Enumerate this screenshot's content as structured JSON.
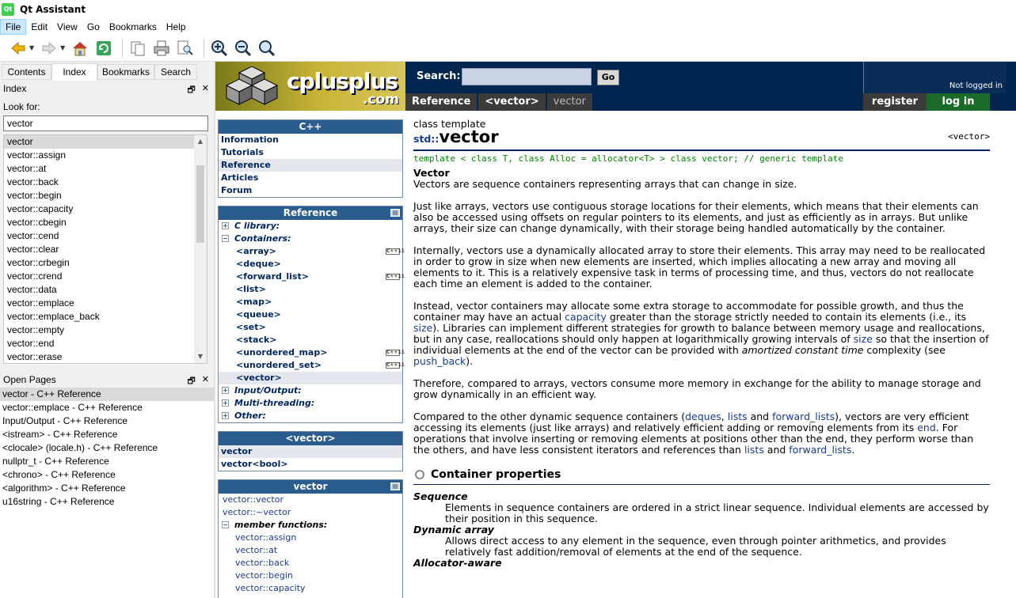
{
  "window": {
    "title": "Qt Assistant",
    "app_icon_label": "Qt"
  },
  "menu": [
    "File",
    "Edit",
    "View",
    "Go",
    "Bookmarks",
    "Help"
  ],
  "left_tabs": [
    "Contents",
    "Index",
    "Bookmarks",
    "Search"
  ],
  "index": {
    "dock_title": "Index",
    "look_for_label": "Look for:",
    "search_value": "vector",
    "items": [
      "vector",
      "vector::assign",
      "vector::at",
      "vector::back",
      "vector::begin",
      "vector::capacity",
      "vector::cbegin",
      "vector::cend",
      "vector::clear",
      "vector::crbegin",
      "vector::crend",
      "vector::data",
      "vector::emplace",
      "vector::emplace_back",
      "vector::empty",
      "vector::end",
      "vector::erase"
    ]
  },
  "open_pages": {
    "dock_title": "Open Pages",
    "items": [
      "vector - C++ Reference",
      "vector::emplace - C++ Reference",
      "Input/Output - C++ Reference",
      "<istream> - C++ Reference",
      "<clocale> (locale.h) - C++ Reference",
      "nullptr_t - C++ Reference",
      "<chrono> - C++ Reference",
      "<algorithm> - C++ Reference",
      "u16string - C++ Reference"
    ]
  },
  "site": {
    "logo_word": "cplusplus",
    "logo_com": ".com",
    "search_label": "Search:",
    "go_label": "Go",
    "not_logged": "Not logged in",
    "register_label": "register",
    "login_label": "log in",
    "breadcrumbs": [
      "Reference",
      "<vector>",
      "vector"
    ]
  },
  "nav": {
    "cpp_box": {
      "title": "C++",
      "links": [
        "Information",
        "Tutorials",
        "Reference",
        "Articles",
        "Forum"
      ]
    },
    "ref_box": {
      "title": "Reference",
      "cats": [
        "C library:",
        "Containers:"
      ],
      "headers": [
        "<array>",
        "<deque>",
        "<forward_list>",
        "<list>",
        "<map>",
        "<queue>",
        "<set>",
        "<stack>",
        "<unordered_map>",
        "<unordered_set>",
        "<vector>"
      ],
      "cats2": [
        "Input/Output:",
        "Multi-threading:",
        "Other:"
      ],
      "cxx_badge": "C++11"
    },
    "vector_box": {
      "title": "<vector>",
      "links": [
        "vector",
        "vector<bool>"
      ]
    },
    "members_box": {
      "title": "vector",
      "items": [
        "vector::vector",
        "vector::~vector"
      ],
      "cat": "member functions:",
      "subs": [
        "vector::assign",
        "vector::at",
        "vector::back",
        "vector::begin",
        "vector::capacity"
      ]
    }
  },
  "article": {
    "class_template": "class template",
    "ns": "std::",
    "name": "vector",
    "header": "<vector>",
    "decl": "template < class T, class Alloc = allocator<T> > class vector; // generic template",
    "subtitle": "Vector",
    "p1": "Vectors are sequence containers representing arrays that can change in size.",
    "p2": "Just like arrays, vectors use contiguous storage locations for their elements, which means that their elements can also be accessed using offsets on regular pointers to its elements, and just as efficiently as in arrays. But unlike arrays, their size can change dynamically, with their storage being handled automatically by the container.",
    "p3": "Internally, vectors use a dynamically allocated array to store their elements. This array may need to be reallocated in order to grow in size when new elements are inserted, which implies allocating a new array and moving all elements to it. This is a relatively expensive task in terms of processing time, and thus, vectors do not reallocate each time an element is added to the container.",
    "p4a": "Instead, vector containers may allocate some extra storage to accommodate for possible growth, and thus the container may have an actual ",
    "p4_capacity": "capacity",
    "p4b": " greater than the storage strictly needed to contain its elements (i.e., its ",
    "p4_size": "size",
    "p4c": "). Libraries can implement different strategies for growth to balance between memory usage and reallocations, but in any case, reallocations should only happen at logarithmically growing intervals of ",
    "p4_size2": "size",
    "p4d": " so that the insertion of individual elements at the end of the vector can be provided with ",
    "p4_amortized": "amortized constant time",
    "p4e": " complexity (see ",
    "p4_push": "push_back",
    "p4f": ").",
    "p5": "Therefore, compared to arrays, vectors consume more memory in exchange for the ability to manage storage and grow dynamically in an efficient way.",
    "p6a": "Compared to the other dynamic sequence containers (",
    "p6_deques": "deques",
    "p6_sep1": ", ",
    "p6_lists": "lists",
    "p6_and": " and ",
    "p6_fwd": "forward_lists",
    "p6b": "), vectors are very efficient accessing its elements (just like arrays) and relatively efficient adding or removing elements from its ",
    "p6_end": "end",
    "p6c": ". For operations that involve inserting or removing elements at positions other than the end, they perform worse than the others, and have less consistent iterators and references than ",
    "p6_lists2": "lists",
    "p6_and2": " and ",
    "p6_fwd2": "forward_lists",
    "p6d": ".",
    "props_title": "Container properties",
    "props": [
      {
        "term": "Sequence",
        "desc": "Elements in sequence containers are ordered in a strict linear sequence. Individual elements are accessed by their position in this sequence."
      },
      {
        "term": "Dynamic array",
        "desc": "Allows direct access to any element in the sequence, even through pointer arithmetics, and provides relatively fast addition/removal of elements at the end of the sequence."
      },
      {
        "term": "Allocator-aware",
        "desc": ""
      }
    ]
  }
}
